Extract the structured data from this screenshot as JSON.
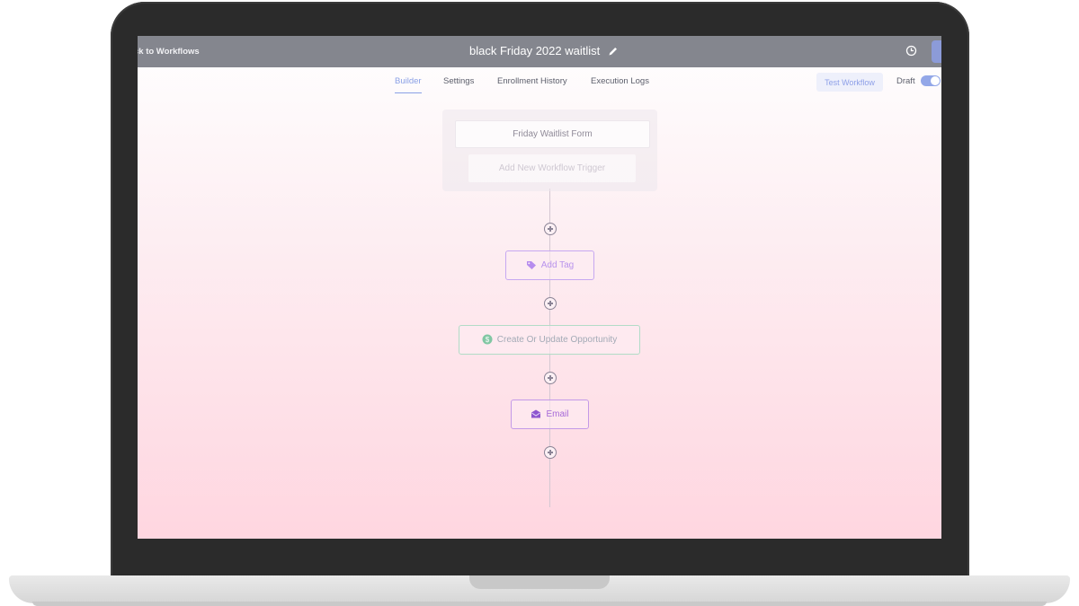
{
  "header": {
    "back_label": "ck to Workflows",
    "title": "black Friday 2022 waitlist"
  },
  "tabs": [
    {
      "label": "Builder",
      "active": true
    },
    {
      "label": "Settings",
      "active": false
    },
    {
      "label": "Enrollment History",
      "active": false
    },
    {
      "label": "Execution Logs",
      "active": false
    }
  ],
  "actions": {
    "test_workflow_label": "Test Workflow",
    "draft_label": "Draft",
    "draft_toggle_on": true
  },
  "trigger": {
    "name": "Friday Waitlist Form",
    "add_label": "Add New Workflow Trigger"
  },
  "steps": [
    {
      "label": "Add Tag",
      "icon": "tag-icon"
    },
    {
      "label": "Create Or Update Opportunity",
      "icon": "dollar-icon"
    },
    {
      "label": "Email",
      "icon": "email-icon"
    }
  ],
  "colors": {
    "accent": "#8aa0e6",
    "topbar": "#84868e",
    "tag_border": "#c6a8f1",
    "opportunity_border": "#b2dcc7",
    "email_border": "#c39ae8"
  }
}
